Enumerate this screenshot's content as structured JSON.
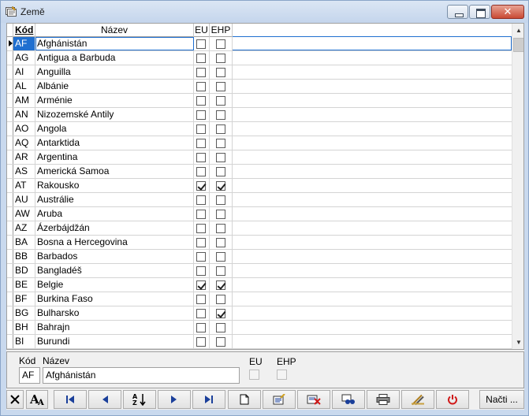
{
  "window": {
    "title": "Země"
  },
  "grid": {
    "columns": {
      "kod": "Kód",
      "nazev": "Název",
      "eu": "EU",
      "ehp": "EHP"
    },
    "rows": [
      {
        "kod": "AF",
        "nazev": "Afghánistán",
        "eu": false,
        "ehp": false
      },
      {
        "kod": "AG",
        "nazev": "Antigua a Barbuda",
        "eu": false,
        "ehp": false
      },
      {
        "kod": "AI",
        "nazev": "Anguilla",
        "eu": false,
        "ehp": false
      },
      {
        "kod": "AL",
        "nazev": "Albánie",
        "eu": false,
        "ehp": false
      },
      {
        "kod": "AM",
        "nazev": "Arménie",
        "eu": false,
        "ehp": false
      },
      {
        "kod": "AN",
        "nazev": "Nizozemské Antily",
        "eu": false,
        "ehp": false
      },
      {
        "kod": "AO",
        "nazev": "Angola",
        "eu": false,
        "ehp": false
      },
      {
        "kod": "AQ",
        "nazev": "Antarktida",
        "eu": false,
        "ehp": false
      },
      {
        "kod": "AR",
        "nazev": "Argentina",
        "eu": false,
        "ehp": false
      },
      {
        "kod": "AS",
        "nazev": "Americká Samoa",
        "eu": false,
        "ehp": false
      },
      {
        "kod": "AT",
        "nazev": "Rakousko",
        "eu": true,
        "ehp": true
      },
      {
        "kod": "AU",
        "nazev": "Austrálie",
        "eu": false,
        "ehp": false
      },
      {
        "kod": "AW",
        "nazev": "Aruba",
        "eu": false,
        "ehp": false
      },
      {
        "kod": "AZ",
        "nazev": "Ázerbájdžán",
        "eu": false,
        "ehp": false
      },
      {
        "kod": "BA",
        "nazev": "Bosna a Hercegovina",
        "eu": false,
        "ehp": false
      },
      {
        "kod": "BB",
        "nazev": "Barbados",
        "eu": false,
        "ehp": false
      },
      {
        "kod": "BD",
        "nazev": "Bangladéš",
        "eu": false,
        "ehp": false
      },
      {
        "kod": "BE",
        "nazev": "Belgie",
        "eu": true,
        "ehp": true
      },
      {
        "kod": "BF",
        "nazev": "Burkina Faso",
        "eu": false,
        "ehp": false
      },
      {
        "kod": "BG",
        "nazev": "Bulharsko",
        "eu": false,
        "ehp": true
      },
      {
        "kod": "BH",
        "nazev": "Bahrajn",
        "eu": false,
        "ehp": false
      },
      {
        "kod": "BI",
        "nazev": "Burundi",
        "eu": false,
        "ehp": false
      }
    ]
  },
  "detail": {
    "kod_label": "Kód",
    "nazev_label": "Název",
    "eu_label": "EU",
    "ehp_label": "EHP",
    "kod_value": "AF",
    "nazev_value": "Afghánistán"
  },
  "toolbar": {
    "buttons": [
      {
        "name": "close-x-button",
        "icon": "close-icon"
      },
      {
        "name": "font-button",
        "icon": "font-icon"
      },
      {
        "name": "first-record-button",
        "icon": "first-icon"
      },
      {
        "name": "previous-record-button",
        "icon": "previous-icon"
      },
      {
        "name": "sort-button",
        "icon": "sort-az-icon"
      },
      {
        "name": "next-record-button",
        "icon": "next-icon"
      },
      {
        "name": "last-record-button",
        "icon": "last-icon"
      },
      {
        "name": "new-record-button",
        "icon": "new-document-icon"
      },
      {
        "name": "edit-record-button",
        "icon": "edit-icon"
      },
      {
        "name": "delete-record-button",
        "icon": "delete-icon"
      },
      {
        "name": "search-button",
        "icon": "binoculars-icon"
      },
      {
        "name": "print-button",
        "icon": "printer-icon"
      },
      {
        "name": "tools-button",
        "icon": "tools-icon"
      },
      {
        "name": "power-button",
        "icon": "power-icon"
      }
    ],
    "load_label": "Načti ..."
  },
  "colors": {
    "selection": "#1f6fd0",
    "window_frame": "#c9d9ee",
    "close_button": "#c94a34"
  }
}
